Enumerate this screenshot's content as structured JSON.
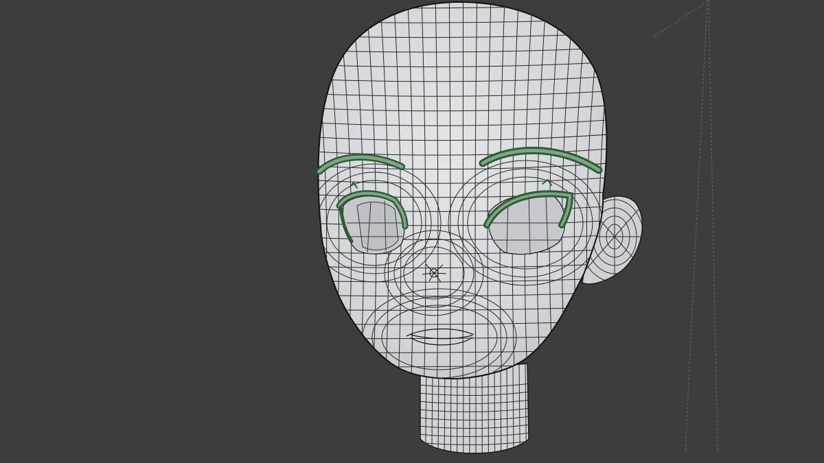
{
  "viewport": {
    "mode": "3d-viewport",
    "shading": "solid-wireframe",
    "colors": {
      "background": "#3d3d3d",
      "mesh_fill": "#d9dadc",
      "mesh_shadow": "#b9bbbf",
      "wire": "#1a1a1a",
      "eyelash": "#3f6a45",
      "eye_white": "#c9cace",
      "camera_guide": "#6a6a6a"
    },
    "objects": [
      {
        "name": "head-mesh",
        "icon": "mesh-icon"
      },
      {
        "name": "eyelash-mesh",
        "icon": "mesh-icon"
      },
      {
        "name": "eyebrow-mesh",
        "icon": "mesh-icon"
      }
    ]
  }
}
